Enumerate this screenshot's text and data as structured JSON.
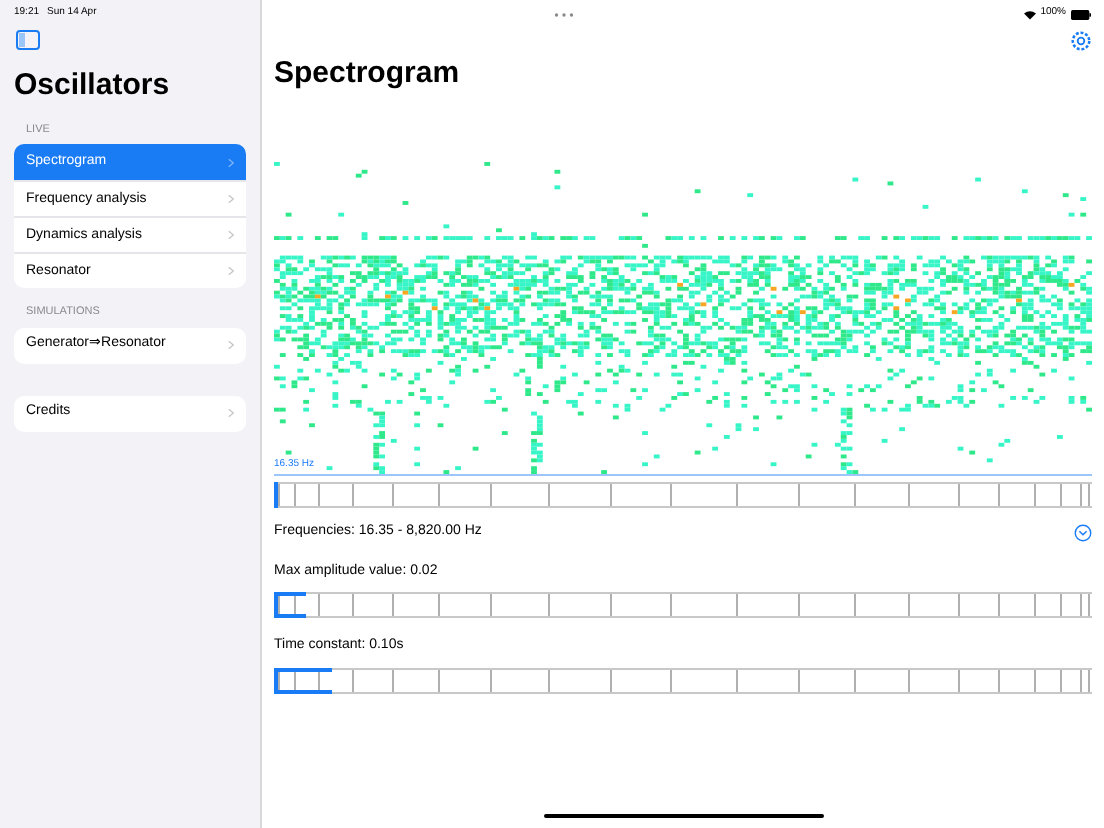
{
  "status_bar": {
    "time": "19:21",
    "date": "Sun 14 Apr",
    "battery": "100%"
  },
  "sidebar": {
    "title": "Oscillators",
    "sections": [
      {
        "header": "LIVE",
        "items": [
          {
            "label": "Spectrogram",
            "selected": true
          },
          {
            "label": "Frequency analysis",
            "selected": false
          },
          {
            "label": "Dynamics analysis",
            "selected": false
          },
          {
            "label": "Resonator",
            "selected": false
          }
        ]
      },
      {
        "header": "SIMULATIONS",
        "items": [
          {
            "label": "Generator⇒Resonator",
            "selected": false
          }
        ]
      },
      {
        "items": [
          {
            "label": "Credits",
            "selected": false
          }
        ]
      }
    ]
  },
  "main": {
    "title": "Spectrogram",
    "spectrogram_label": "16.35 Hz",
    "controls": [
      {
        "label": "Frequencies: 16.35 - 8,820.00 Hz",
        "level": 0.005,
        "expandable": true
      },
      {
        "label": "Max amplitude value: 0.02",
        "level": 0.04,
        "expandable": false
      },
      {
        "label": "Time constant: 0.10s",
        "level": 0.07,
        "expandable": false
      }
    ]
  }
}
